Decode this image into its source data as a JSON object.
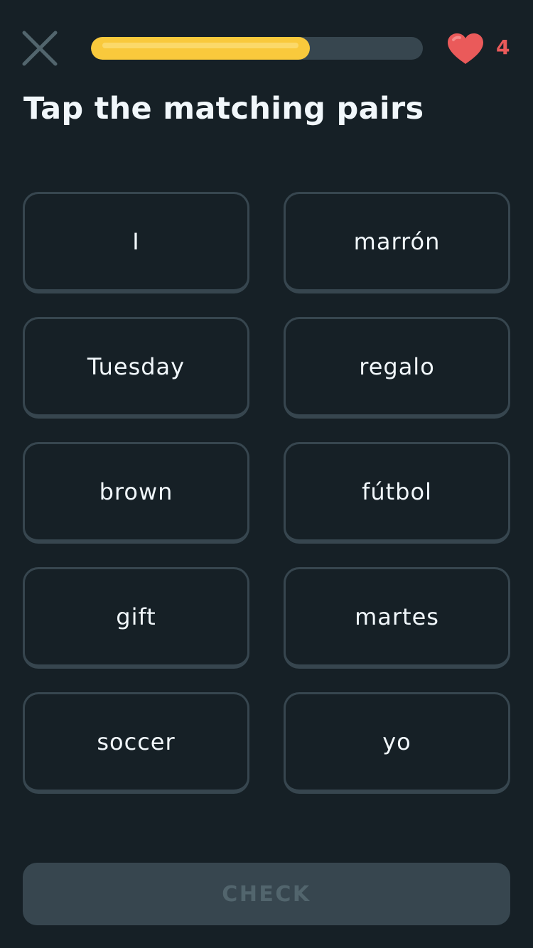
{
  "header": {
    "progress_fraction": 0.66,
    "hearts_count": "4",
    "colors": {
      "progress": "#f9c93c",
      "heart": "#ea5a5a"
    }
  },
  "icons": {
    "close": "close-icon",
    "heart": "heart-icon"
  },
  "title": "Tap the matching pairs",
  "tiles": {
    "left": [
      "I",
      "Tuesday",
      "brown",
      "gift",
      "soccer"
    ],
    "right": [
      "marrón",
      "regalo",
      "fútbol",
      "martes",
      "yo"
    ]
  },
  "check_button": {
    "label": "CHECK"
  }
}
